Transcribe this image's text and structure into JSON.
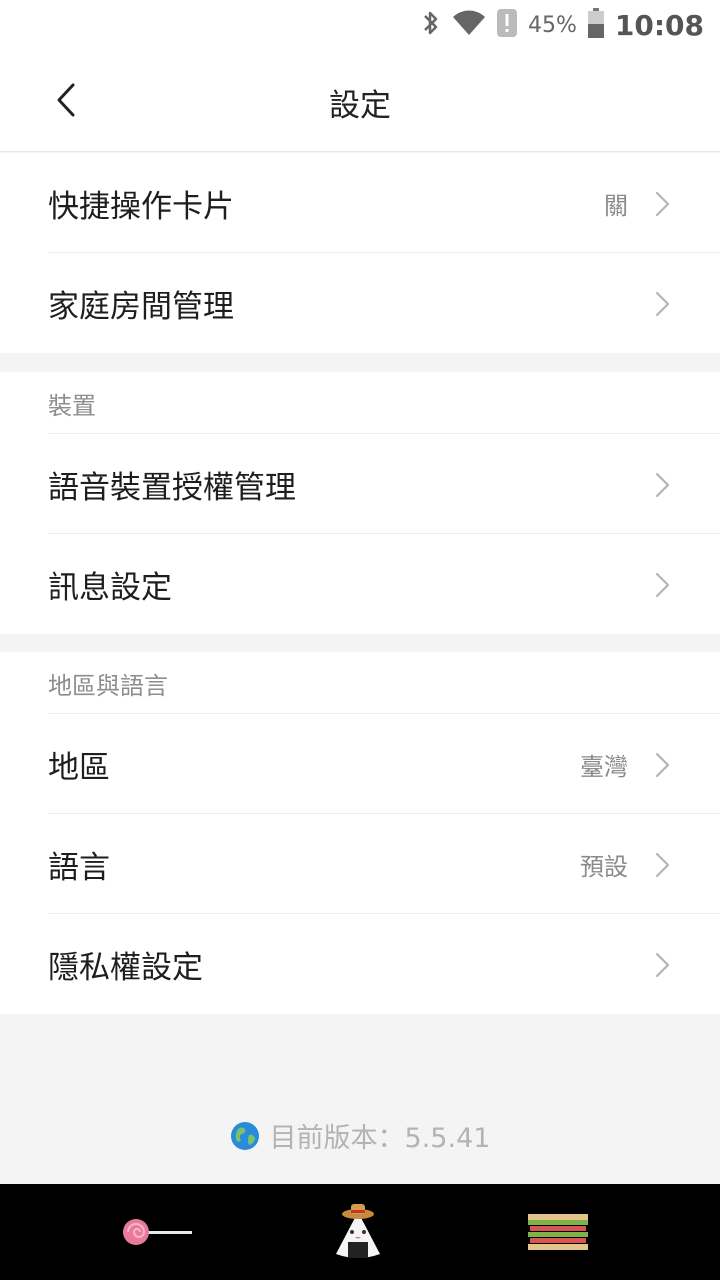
{
  "status_bar": {
    "battery_percent": "45%",
    "time": "10:08",
    "icons": [
      "bluetooth-icon",
      "wifi-icon",
      "alert-icon",
      "battery-icon"
    ]
  },
  "header": {
    "title": "設定"
  },
  "sections": {
    "general": {
      "items": [
        {
          "label": "快捷操作卡片",
          "value": "關"
        },
        {
          "label": "家庭房間管理",
          "value": ""
        }
      ]
    },
    "device": {
      "header": "裝置",
      "items": [
        {
          "label": "語音裝置授權管理",
          "value": ""
        },
        {
          "label": "訊息設定",
          "value": ""
        }
      ]
    },
    "region_language": {
      "header": "地區與語言",
      "items": [
        {
          "label": "地區",
          "value": "臺灣"
        },
        {
          "label": "語言",
          "value": "預設"
        },
        {
          "label": "隱私權設定",
          "value": ""
        }
      ]
    }
  },
  "footer": {
    "version_text": "目前版本：5.5.41"
  },
  "colors": {
    "background": "#f4f4f4",
    "card": "#ffffff",
    "text_primary": "#1e1e1e",
    "text_secondary": "#8a8a8a",
    "chevron": "#b5b5b5",
    "globe": "#2a8bd8"
  }
}
